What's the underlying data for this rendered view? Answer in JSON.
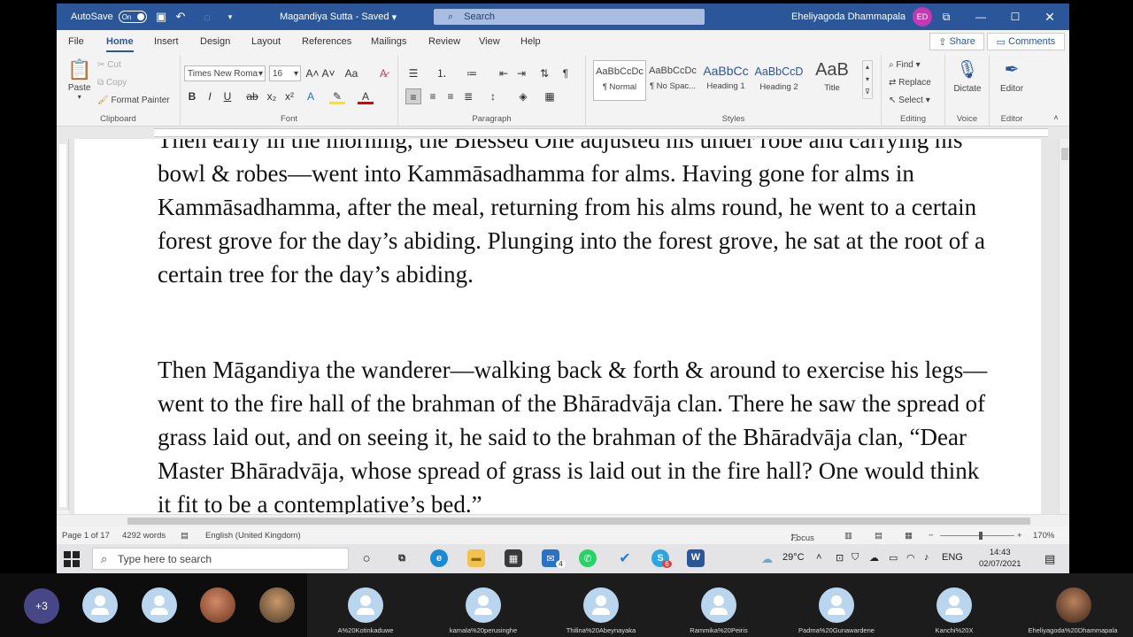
{
  "titlebar": {
    "autosave_label": "AutoSave",
    "autosave_state": "On",
    "doc_title": "Magandiya Sutta  -  Saved",
    "search_placeholder": "Search",
    "user_name": "Eheliyagoda Dhammapala",
    "user_initials": "ED"
  },
  "tabs": [
    "File",
    "Home",
    "Insert",
    "Design",
    "Layout",
    "References",
    "Mailings",
    "Review",
    "View",
    "Help"
  ],
  "actions": {
    "share": "Share",
    "comments": "Comments"
  },
  "ribbon": {
    "clipboard": {
      "paste": "Paste",
      "cut": "Cut",
      "copy": "Copy",
      "format_painter": "Format Painter",
      "label": "Clipboard"
    },
    "font": {
      "name": "Times New Roma",
      "size": "16",
      "label": "Font"
    },
    "paragraph": {
      "label": "Paragraph"
    },
    "styles": {
      "label": "Styles",
      "items": [
        {
          "sample": "AaBbCcDc",
          "name": "¶ Normal"
        },
        {
          "sample": "AaBbCcDc",
          "name": "¶ No Spac..."
        },
        {
          "sample": "AaBbCc",
          "name": "Heading 1"
        },
        {
          "sample": "AaBbCcD",
          "name": "Heading 2"
        },
        {
          "sample": "AaB",
          "name": "Title"
        }
      ]
    },
    "editing": {
      "find": "Find",
      "replace": "Replace",
      "select": "Select",
      "label": "Editing"
    },
    "voice": {
      "dictate": "Dictate",
      "label": "Voice"
    },
    "editor": {
      "editor": "Editor",
      "label": "Editor"
    }
  },
  "document": {
    "paragraph1": "Then early in the morning, the Blessed One adjusted his under robe and carrying his bowl & robes—went into Kammāsadhamma for alms. Having gone for alms in Kammāsadhamma, after the meal, returning from his alms round, he went to a certain forest grove for the day’s abiding. Plunging into the forest grove, he sat at the root of a certain tree for the day’s abiding.",
    "paragraph2": "Then Māgandiya the wanderer—walking back & forth & around to exercise his legs—went to the fire hall of the brahman of the Bhāradvāja clan. There he saw the spread of grass laid out, and on seeing it, he said to the brahman of the Bhāradvāja clan, “Dear Master Bhāradvāja, whose spread of grass is laid out in the fire hall? One would think it fit to be a contemplative’s bed.”"
  },
  "status": {
    "page": "Page 1 of 17",
    "words": "4292 words",
    "language": "English (United Kingdom)",
    "focus": "Focus",
    "zoom": "170%"
  },
  "taskbar": {
    "search_placeholder": "Type here to search",
    "weather": "29°C",
    "lang": "ENG",
    "time": "14:43",
    "date": "02/07/2021",
    "mail_badge": "4",
    "skype_badge": "6"
  },
  "participants": {
    "overflow": "+3",
    "names": [
      "A%20Kotinkaduwe",
      "kamala%20perusinghe",
      "Thilina%20Abeynayaka",
      "Rammika%20Peiris",
      "Padma%20Gunawardene",
      "Kanchi%20X",
      "Eheliyagoda%20Dhammapala"
    ]
  }
}
